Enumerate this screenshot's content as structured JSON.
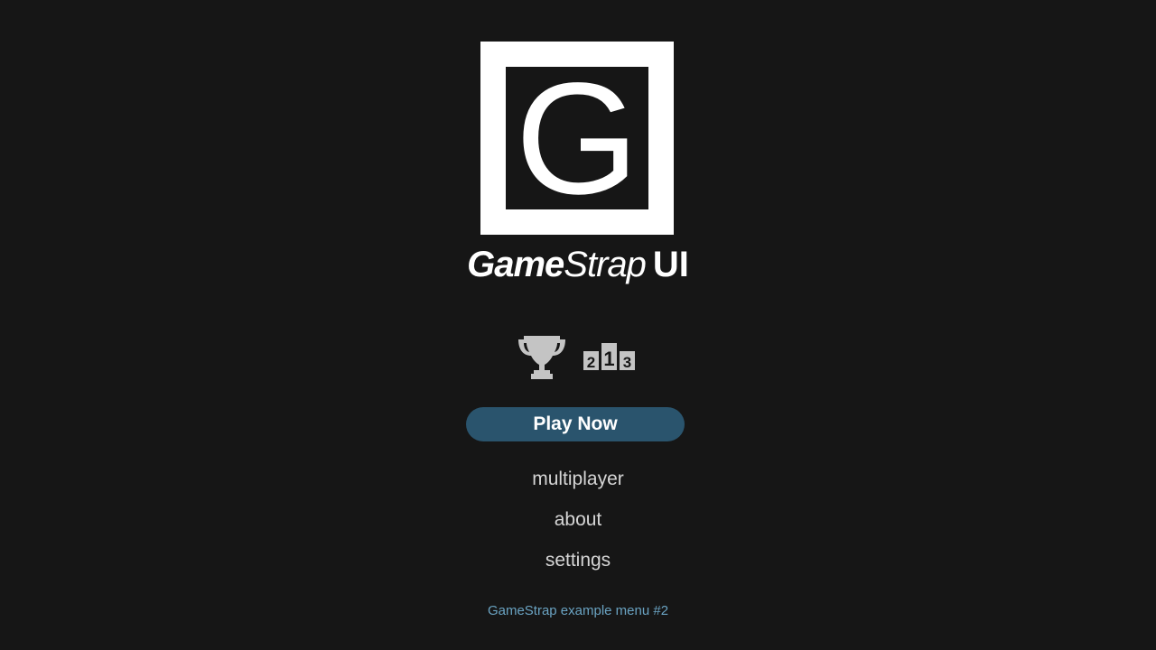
{
  "logo": {
    "letter": "G",
    "brand_part1": "Game",
    "brand_part2": "Strap",
    "brand_part3": "UI"
  },
  "icons": {
    "trophy": "trophy-icon",
    "leaderboard": "leaderboard-podium-icon",
    "podium_digits": [
      "2",
      "1",
      "3"
    ]
  },
  "menu": {
    "play_label": "Play Now",
    "multiplayer_label": "multiplayer",
    "about_label": "about",
    "settings_label": "settings"
  },
  "footer": {
    "caption": "GameStrap example menu #2"
  },
  "colors": {
    "background": "#161616",
    "play_button": "#2a546d",
    "menu_text": "#d6d6d6",
    "footer_text": "#6aa3c2",
    "icon_gray": "#c4c4c4"
  }
}
